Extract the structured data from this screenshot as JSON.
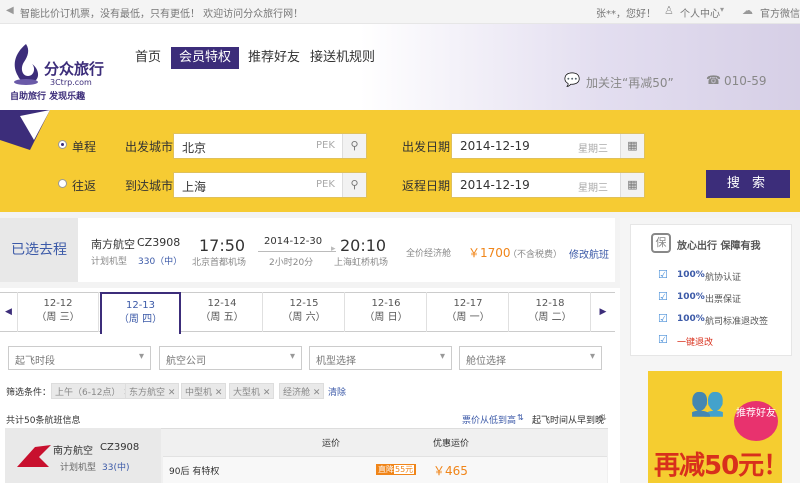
{
  "topbar": {
    "slogan": "智能比价订机票，没有最低，只有更低！ 欢迎访问分众旅行网！",
    "user_greeting": "张**，您好！",
    "user_center": "个人中心",
    "wechat": "官方微信"
  },
  "header": {
    "logo_text": "分众旅行",
    "logo_domain": "3Ctrp.com",
    "logo_slogan": "自助旅行 发现乐趣",
    "nav": [
      "首页",
      "会员特权",
      "推荐好友",
      "接送机规则"
    ],
    "follow_text": "加关注“再减50”",
    "phone": "010-59"
  },
  "search": {
    "trip_types": [
      "单程",
      "往返"
    ],
    "selected_trip": "单程",
    "depart_city_label": "出发城市",
    "depart_city": "北京",
    "depart_code": "PEK",
    "arrive_city_label": "到达城市",
    "arrive_city": "上海",
    "arrive_code": "PEK",
    "depart_date_label": "出发日期",
    "depart_date": "2014-12-19",
    "depart_weekday": "星期三",
    "return_date_label": "返程日期",
    "return_date": "2014-12-19",
    "return_weekday": "星期三",
    "search_button": "搜 索"
  },
  "selected_flight": {
    "label": "已选去程",
    "airline": "南方航空",
    "flight_no": "CZ3908",
    "plane_label": "计划机型",
    "plane_value": "330（中）",
    "depart_time": "17:50",
    "depart_airport": "北京首都机场",
    "date": "2014-12-30",
    "duration": "2小时20分",
    "arrive_time": "20:10",
    "arrive_airport": "上海虹桥机场",
    "cabin": "全价经济舱",
    "price": "￥1700",
    "tax_note": "（不含税费）",
    "change_link": "修改航班"
  },
  "dates": [
    {
      "date": "12-12",
      "weekday": "（周 三）"
    },
    {
      "date": "12-13",
      "weekday": "（周 四）"
    },
    {
      "date": "12-14",
      "weekday": "（周 五）"
    },
    {
      "date": "12-15",
      "weekday": "（周 六）"
    },
    {
      "date": "12-16",
      "weekday": "（周 日）"
    },
    {
      "date": "12-17",
      "weekday": "（周 一）"
    },
    {
      "date": "12-18",
      "weekday": "（周 二）"
    }
  ],
  "filters": {
    "dropdowns": [
      "起飞时段",
      "航空公司",
      "机型选择",
      "舱位选择"
    ],
    "condition_label": "筛选条件：",
    "tags": [
      "上午（6-12点）",
      "东方航空",
      "中型机",
      "大型机",
      "经济舱"
    ],
    "clear": "清除"
  },
  "results": {
    "count_text": "共计50条航班信息",
    "sort_price": "票价从低到高",
    "sort_time": "起飞时间从早到晚",
    "col_price": "运价",
    "col_discount_price": "优惠运价",
    "row": {
      "airline": "南方航空",
      "flight_no": "CZ3908",
      "plane_label": "计划机型",
      "plane_value": "33(中)",
      "special": "90后 有特权",
      "badge": "直降",
      "badge_amount": "55元",
      "price": "￥465"
    }
  },
  "sidebar": {
    "title": "放心出行 保障有我",
    "items": [
      {
        "pct": "100%",
        "text": "航协认证"
      },
      {
        "pct": "100%",
        "text": "出票保证"
      },
      {
        "pct": "100%",
        "text": "航司标准退改签"
      },
      {
        "pct": "",
        "text": "一键退改"
      }
    ],
    "ad_badge": "推荐好友",
    "ad_text": "再减50元！"
  },
  "colors": {
    "brand_purple": "#3c2d7a",
    "search_yellow": "#f6cb33",
    "price_orange": "#f08519",
    "link_blue": "#3c5aa8"
  }
}
